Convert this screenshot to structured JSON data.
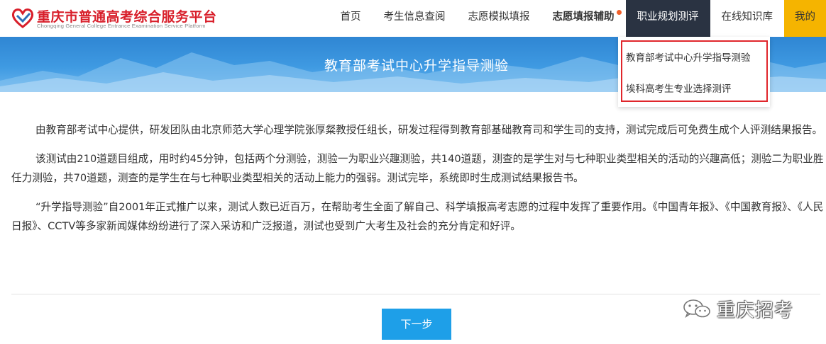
{
  "header": {
    "logo_title": "重庆市普通高考综合服务平台",
    "logo_subtitle": "Chongqing General College Entrance Examination Service Platform"
  },
  "nav": {
    "items": [
      {
        "label": "首页"
      },
      {
        "label": "考生信息查阅"
      },
      {
        "label": "志愿模拟填报"
      },
      {
        "label": "志愿填报辅助"
      },
      {
        "label": "职业规划测评"
      },
      {
        "label": "在线知识库"
      },
      {
        "label": "我的"
      }
    ]
  },
  "dropdown": {
    "items": [
      {
        "label": "教育部考试中心升学指导测验"
      },
      {
        "label": "埃科高考生专业选择测评"
      }
    ]
  },
  "banner": {
    "title": "教育部考试中心升学指导测验"
  },
  "content": {
    "paragraphs": [
      "由教育部考试中心提供，研发团队由北京师范大学心理学院张厚粲教授任组长，研发过程得到教育部基础教育司和学生司的支持，测试完成后可免费生成个人评测结果报告。",
      "该测试由210道题目组成，用时约45分钟，包括两个分测验，测验一为职业兴趣测验，共140道题，测查的是学生对与七种职业类型相关的活动的兴趣高低；测验二为职业胜任力测验，共70道题，测查的是学生在与七种职业类型相关的活动上能力的强弱。测试完毕，系统即时生成测试结果报告书。",
      "“升学指导测验”自2001年正式推广以来，测试人数已近百万，在帮助考生全面了解自己、科学填报高考志愿的过程中发挥了重要作用。《中国青年报》、《中国教育报》、《人民日报》、CCTV等多家新闻媒体纷纷进行了深入采访和广泛报道，测试也受到广大考生及社会的充分肯定和好评。"
    ]
  },
  "actions": {
    "next_label": "下一步"
  },
  "watermark": {
    "text": "重庆招考",
    "icon": "wechat-icon"
  },
  "colors": {
    "brand_red": "#d81e2a",
    "nav_active_bg": "#2a3342",
    "nav_mine_bg": "#f5b400",
    "highlight_border": "#e0262b",
    "button_blue": "#1e9fe8",
    "banner_blue": "#3f9ae2"
  }
}
